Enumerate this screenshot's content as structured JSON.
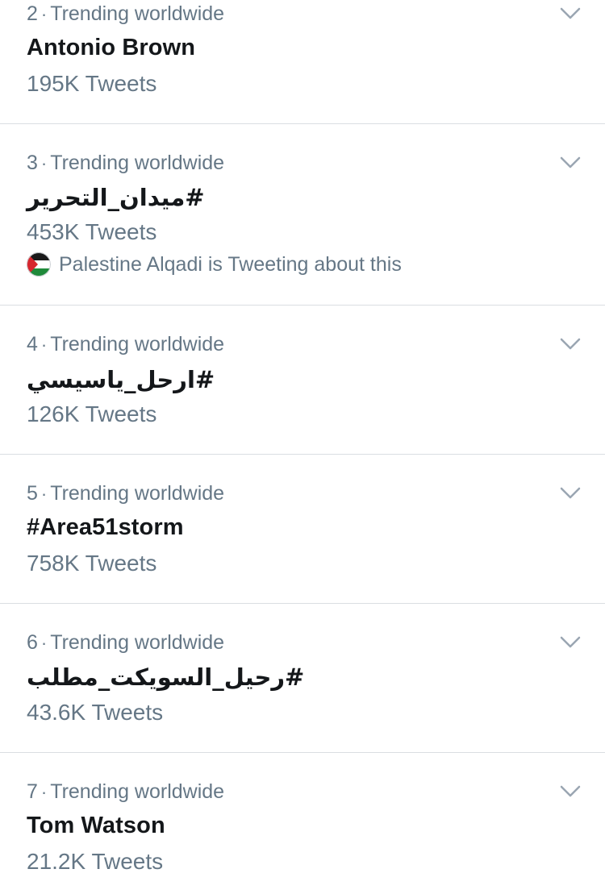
{
  "trends": [
    {
      "rank": "2",
      "label": "Trending worldwide",
      "name": "Antonio Brown",
      "rtl": false,
      "count": "195K Tweets"
    },
    {
      "rank": "3",
      "label": "Trending worldwide",
      "name": "#ميدان_التحرير",
      "rtl": true,
      "count": "453K Tweets",
      "context": "Palestine Alqadi is Tweeting about this"
    },
    {
      "rank": "4",
      "label": "Trending worldwide",
      "name": "#ارحل_ياسيسي",
      "rtl": true,
      "count": "126K Tweets"
    },
    {
      "rank": "5",
      "label": "Trending worldwide",
      "name": "#Area51storm",
      "rtl": false,
      "count": "758K Tweets"
    },
    {
      "rank": "6",
      "label": "Trending worldwide",
      "name": "#رحيل_السويكت_مطلب",
      "rtl": true,
      "count": "43.6K Tweets"
    },
    {
      "rank": "7",
      "label": "Trending worldwide",
      "name": "Tom Watson",
      "rtl": false,
      "count": "21.2K Tweets"
    }
  ],
  "separator": "·",
  "icons": {
    "more": "chevron-down-icon",
    "avatar": "palestine-flag-avatar"
  },
  "colors": {
    "text_primary": "#14171a",
    "text_secondary": "#657786",
    "divider": "#dadee2",
    "chevron": "#9aa6b2"
  }
}
